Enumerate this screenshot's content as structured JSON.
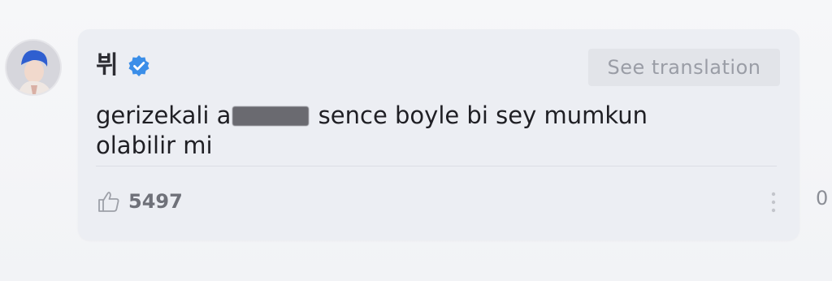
{
  "comment": {
    "author": "뷔",
    "verified_icon": "verified-badge-icon",
    "translate_label": "See translation",
    "text_before_redaction": "gerizekali a",
    "text_after_redaction": " sence boyle bi sey mumkun olabilir mi",
    "like_count": "5497",
    "reply_count": "0"
  },
  "icons": {
    "like": "thumbs-up-icon",
    "more": "more-vertical-icon"
  },
  "colors": {
    "verified": "#3b8ee8",
    "card_bg": "#eceef3"
  }
}
